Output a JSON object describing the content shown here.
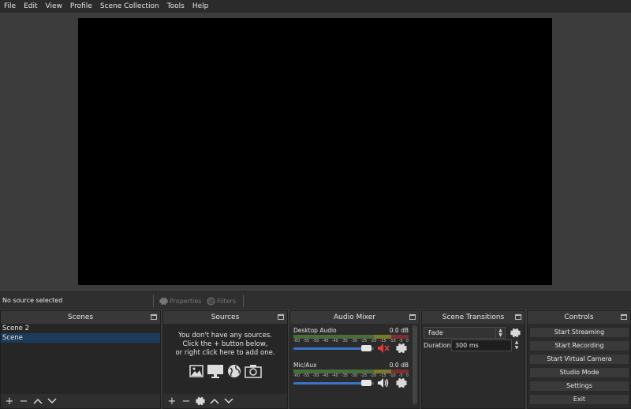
{
  "menu": [
    "File",
    "Edit",
    "View",
    "Profile",
    "Scene Collection",
    "Tools",
    "Help"
  ],
  "infobar": {
    "status": "No source selected",
    "properties_label": "Properties",
    "filters_label": "Filters"
  },
  "scenes": {
    "title": "Scenes",
    "items": [
      "Scene 2",
      "Scene"
    ],
    "selected_index": 1
  },
  "sources": {
    "title": "Sources",
    "empty_line1": "You don't have any sources.",
    "empty_line2": "Click the + button below,",
    "empty_line3": "or right click here to add one."
  },
  "mixer": {
    "title": "Audio Mixer",
    "scale": [
      "-60",
      "-55",
      "-50",
      "-45",
      "-40",
      "-35",
      "-30",
      "-25",
      "-20",
      "-15",
      "-10",
      "-5",
      "0"
    ],
    "tracks": [
      {
        "name": "Desktop Audio",
        "db": "0.0 dB",
        "muted": true,
        "volume": 0.88
      },
      {
        "name": "Mic/Aux",
        "db": "0.0 dB",
        "muted": false,
        "volume": 0.88
      }
    ]
  },
  "transitions": {
    "title": "Scene Transitions",
    "selected": "Fade",
    "duration_label": "Duration",
    "duration_value": "300 ms"
  },
  "controls": {
    "title": "Controls",
    "buttons": [
      "Start Streaming",
      "Start Recording",
      "Start Virtual Camera",
      "Studio Mode",
      "Settings",
      "Exit"
    ]
  },
  "colors": {
    "accent": "#3a74c7",
    "mute_red": "#e03c3c",
    "selection": "#1e3a5a"
  }
}
